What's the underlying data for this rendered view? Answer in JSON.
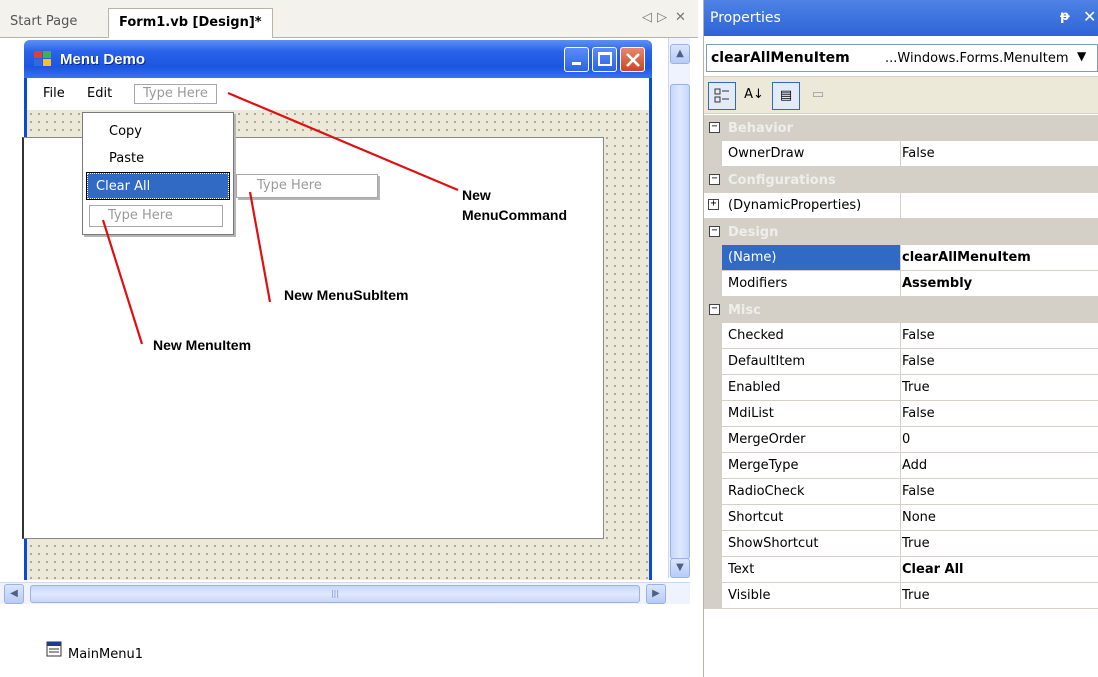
{
  "tabs": {
    "start_page": "Start Page",
    "form_design": "Form1.vb [Design]*",
    "nav_left": "◁",
    "nav_right": "▷",
    "close": "✕"
  },
  "form": {
    "title": "Menu Demo",
    "menu": {
      "file": "File",
      "edit": "Edit",
      "type_here": "Type Here"
    },
    "dropdown": {
      "items": [
        "Copy",
        "Paste",
        "Clear All"
      ],
      "type_here_item": "Type Here",
      "type_here_sub": "Type Here"
    }
  },
  "annotations": {
    "new_menu_command": [
      "New",
      "MenuCommand"
    ],
    "new_menu_subitem": "New MenuSubItem",
    "new_menu_item": "New MenuItem"
  },
  "tray": {
    "component": "MainMenu1"
  },
  "properties": {
    "title": "Properties",
    "pin": "ꟷ",
    "close": "✕",
    "selected_object": "clearAllMenuItem",
    "selected_type": "...Windows.Forms.MenuItem",
    "categories": {
      "behavior": "Behavior",
      "configurations": "Configurations",
      "design": "Design",
      "misc": "Misc"
    },
    "rows": {
      "ownerdraw": {
        "name": "OwnerDraw",
        "value": "False"
      },
      "dynamic": {
        "name": "(DynamicProperties)",
        "value": ""
      },
      "name": {
        "name": "(Name)",
        "value": "clearAllMenuItem"
      },
      "modifiers": {
        "name": "Modifiers",
        "value": "Assembly"
      },
      "checked": {
        "name": "Checked",
        "value": "False"
      },
      "defaultitem": {
        "name": "DefaultItem",
        "value": "False"
      },
      "enabled": {
        "name": "Enabled",
        "value": "True"
      },
      "mdilist": {
        "name": "MdiList",
        "value": "False"
      },
      "mergeorder": {
        "name": "MergeOrder",
        "value": "0"
      },
      "mergetype": {
        "name": "MergeType",
        "value": "Add"
      },
      "radiocheck": {
        "name": "RadioCheck",
        "value": "False"
      },
      "shortcut": {
        "name": "Shortcut",
        "value": "None"
      },
      "showshortcut": {
        "name": "ShowShortcut",
        "value": "True"
      },
      "text": {
        "name": "Text",
        "value": "Clear All"
      },
      "visible": {
        "name": "Visible",
        "value": "True"
      }
    }
  },
  "colors": {
    "titlebar_blue": "#2a63ea",
    "selection_blue": "#316ac5",
    "annotation_red": "#e01010"
  }
}
